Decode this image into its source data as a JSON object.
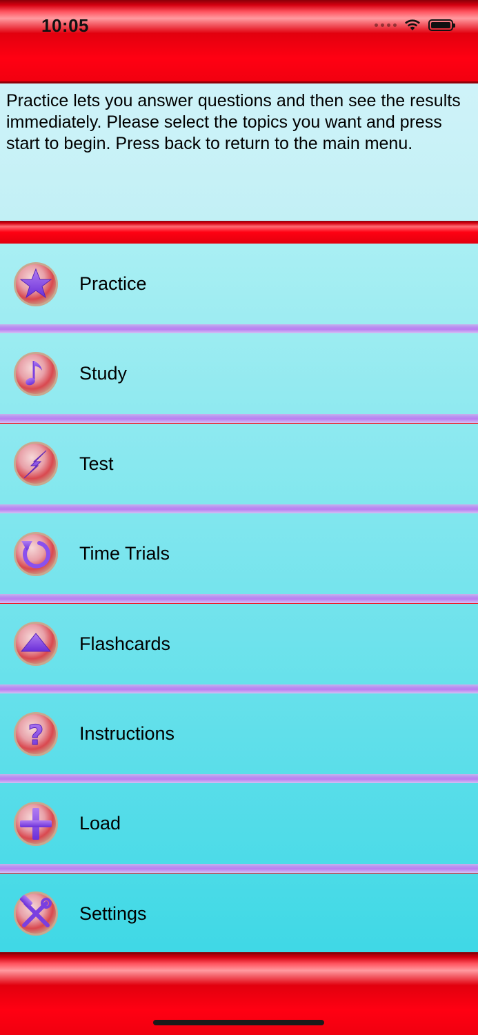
{
  "status_bar": {
    "time": "10:05"
  },
  "description": "Practice lets you answer questions and then see the results immediately. Please select the topics you want and press start to begin. Press back to return to the main menu.",
  "menu": [
    {
      "label": "Practice",
      "icon": "star-icon"
    },
    {
      "label": "Study",
      "icon": "music-note-icon"
    },
    {
      "label": "Test",
      "icon": "lightning-icon"
    },
    {
      "label": "Time Trials",
      "icon": "refresh-icon"
    },
    {
      "label": "Flashcards",
      "icon": "triangle-up-icon"
    },
    {
      "label": "Instructions",
      "icon": "question-icon"
    },
    {
      "label": "Load",
      "icon": "plus-icon"
    },
    {
      "label": "Settings",
      "icon": "tools-icon"
    }
  ],
  "colors": {
    "bar_red": "#ff0010",
    "list_top": "#a9eff3",
    "list_bottom": "#3fd8e6",
    "separator": "#b98cf0",
    "icon_purple": "#7a3fe0"
  }
}
